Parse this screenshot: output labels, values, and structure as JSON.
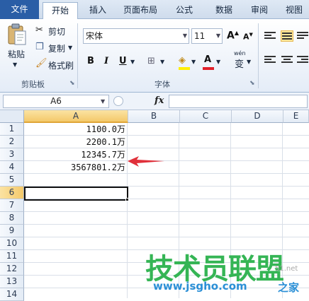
{
  "ribbon_tabs": [
    "文件",
    "开始",
    "插入",
    "页面布局",
    "公式",
    "数据",
    "审阅",
    "视图"
  ],
  "clipboard": {
    "paste_label": "粘贴",
    "cut_label": "剪切",
    "copy_label": "复制",
    "format_painter_label": "格式刷",
    "group_label": "剪贴板"
  },
  "font": {
    "font_name": "宋体",
    "font_size": "11",
    "grow_label": "A",
    "shrink_label": "A",
    "bold_label": "B",
    "italic_label": "I",
    "underline_label": "U",
    "font_color_label": "A",
    "phonetic_label": "wén",
    "phonetic_char": "变",
    "group_label": "字体"
  },
  "formula_bar": {
    "name_box": "A6",
    "fx_label": "fx",
    "formula": ""
  },
  "sheet": {
    "columns": [
      "A",
      "B",
      "C",
      "D",
      "E"
    ],
    "rows": [
      "1",
      "2",
      "3",
      "4",
      "5",
      "6",
      "7",
      "8",
      "9",
      "10",
      "11",
      "12",
      "13",
      "14"
    ],
    "selected_column": "A",
    "selected_row": "6",
    "cells_A": [
      "1100.0万",
      "2200.1万",
      "12345.7万",
      "3567801.2万"
    ]
  },
  "watermark": {
    "text": "技术员联盟",
    "url": "www.jsgho.com",
    "side": "51.net",
    "tail": "之家"
  },
  "colors": {
    "file_tab": "#2a5ea6",
    "arrow": "#e0303a",
    "watermark_green": "#2bb24c"
  }
}
